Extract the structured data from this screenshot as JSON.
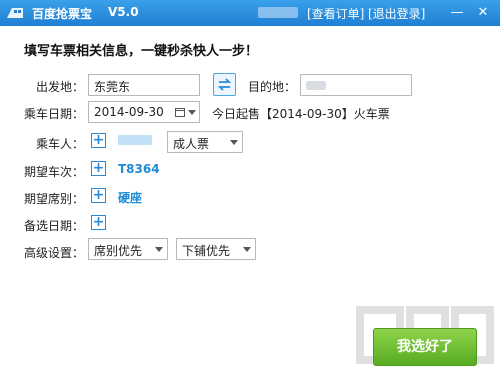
{
  "titlebar": {
    "app_name": "百度抢票宝",
    "version": "V5.0",
    "view_orders": "[查看订单]",
    "logout": "[退出登录]",
    "minimize": "—",
    "close": "✕"
  },
  "headline": "填写车票相关信息，一键秒杀快人一步！",
  "form": {
    "from_label": "出发地：",
    "from_value": "东莞东",
    "to_label": "目的地：",
    "date_label": "乘车日期：",
    "date_value": "2014-09-30",
    "date_note": "今日起售【2014-09-30】火车票",
    "passenger_label": "乘车人：",
    "ticket_type": "成人票",
    "train_label": "期望车次：",
    "train_value": "T8364",
    "seat_label": "期望席别：",
    "seat_value": "硬座",
    "backup_date_label": "备选日期：",
    "advanced_label": "高级设置：",
    "priority_1": "席别优先",
    "priority_2": "下铺优先"
  },
  "submit": "我选好了",
  "colors": {
    "titlebar": "#1e7fd4",
    "accent": "#1f8bd6",
    "submit": "#57ab22"
  }
}
